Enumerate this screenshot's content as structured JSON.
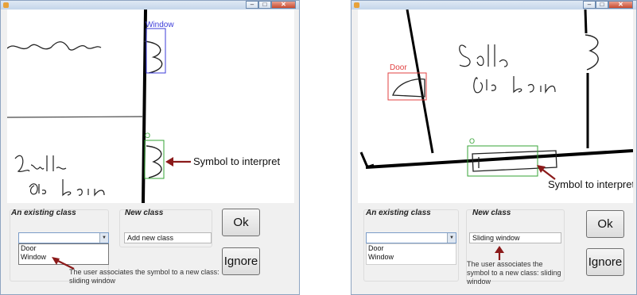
{
  "colors": {
    "door_box": "#e04040",
    "window_box": "#3b3bd9",
    "symbol_box": "#36a336",
    "arrow": "#8b1a1a"
  },
  "left_window": {
    "canvas": {
      "handwritten_1": "ambre",
      "handwritten_2": "Salle",
      "handwritten_3": "de bain",
      "window_label": "Window",
      "symbol_label": "O",
      "annotation": "Symbol to interpret"
    },
    "panel": {
      "existing_class_label": "An existing class",
      "new_class_label": "New class",
      "combo_value": "",
      "list_items": [
        "Door",
        "Window"
      ],
      "new_class_value": "Add new class",
      "ok_label": "Ok",
      "ignore_label": "Ignore",
      "note": "The user associates the symbol to a new class: sliding window"
    }
  },
  "right_window": {
    "canvas": {
      "handwritten_1": "Salle",
      "handwritten_2": "de bain",
      "door_label": "Door",
      "symbol_label": "O",
      "annotation": "Symbol to interpret"
    },
    "panel": {
      "existing_class_label": "An existing class",
      "new_class_label": "New class",
      "combo_value": "",
      "list_items": [
        "Door",
        "Window"
      ],
      "new_class_value": "Sliding window",
      "ok_label": "Ok",
      "ignore_label": "Ignore",
      "note": "The user associates the symbol to a new class: sliding window"
    }
  }
}
